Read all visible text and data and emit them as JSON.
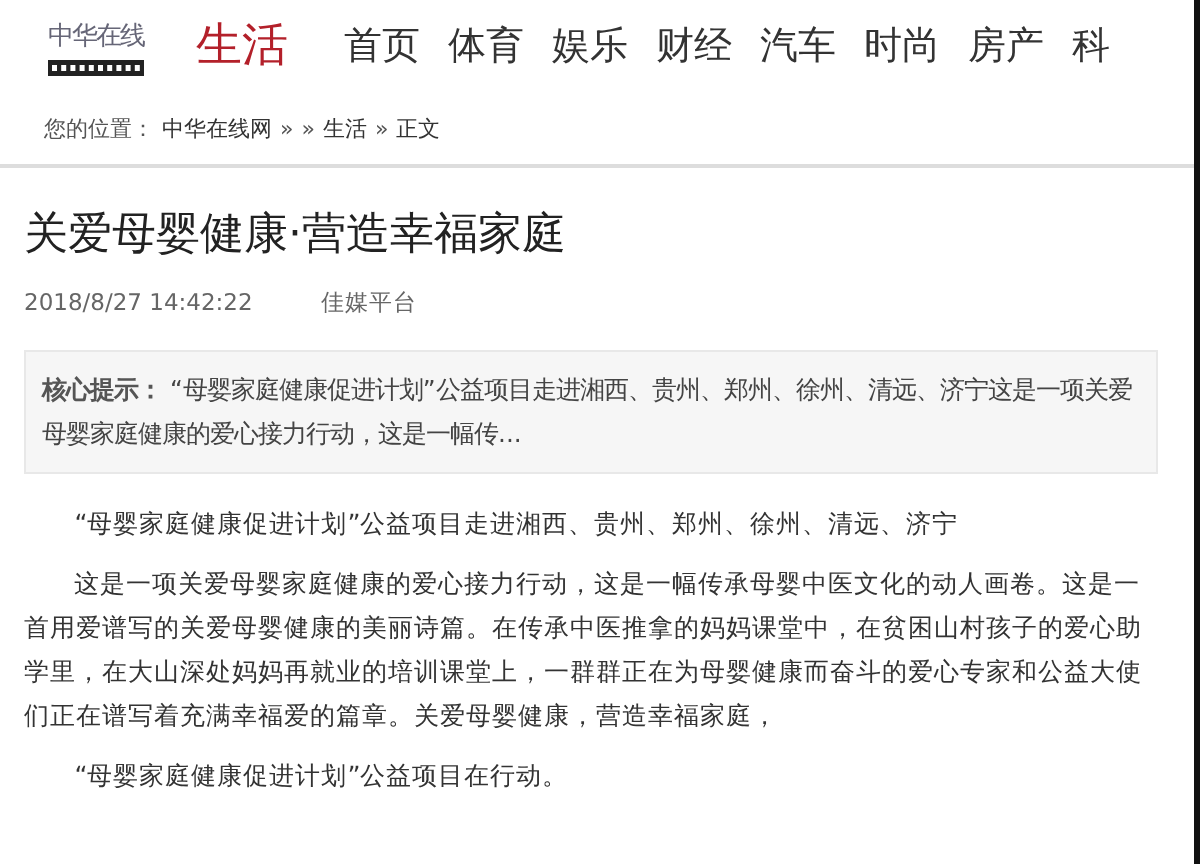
{
  "header": {
    "logo": "中华在线",
    "channel": "生活",
    "nav": [
      {
        "label": "首页"
      },
      {
        "label": "体育"
      },
      {
        "label": "娱乐"
      },
      {
        "label": "财经"
      },
      {
        "label": "汽车"
      },
      {
        "label": "时尚"
      },
      {
        "label": "房产"
      },
      {
        "label": "科"
      }
    ]
  },
  "breadcrumb": {
    "prefix": "您的位置：",
    "items": [
      "中华在线网",
      "»",
      "»",
      "生活",
      "»",
      "正文"
    ]
  },
  "article": {
    "title": "关爱母婴健康·营造幸福家庭",
    "date": "2018/8/27 14:42:22",
    "source": "佳媒平台",
    "summary": "**核心提示：** “母婴家庭健康促进计划”公益项目走进湘西、贵州、郑州、徐州、清远、济宁这是一项关爱母婴家庭健康的爱心接力行动，这是一幅传...",
    "paragraphs": [
      "“母婴家庭健康促进计划”公益项目走进湘西、贵州、郑州、徐州、清远、济宁",
      "这是一项关爱母婴家庭健康的爱心接力行动，这是一幅传承母婴中医文化的动人画卷。这是一首用爱谱写的关爱母婴健康的美丽诗篇。在传承中医推拿的妈妈课堂中，在贫困山村孩子的爱心助学里，在大山深处妈妈再就业的培训课堂上，一群群正在为母婴健康而奋斗的爱心专家和公益大使们正在谱写着充满幸福爱的篇章。关爱母婴健康，营造幸福家庭，",
      "“母婴家庭健康促进计划”公益项目在行动。"
    ]
  }
}
